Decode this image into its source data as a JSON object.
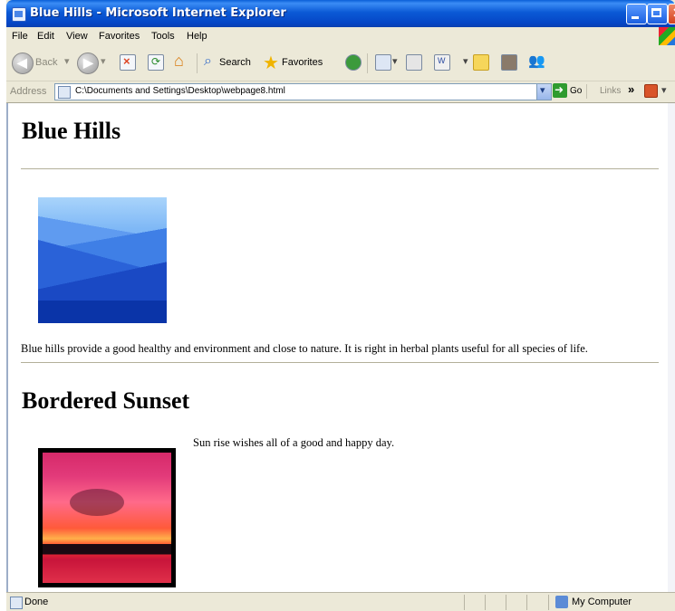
{
  "window": {
    "title": "Blue Hills - Microsoft Internet Explorer"
  },
  "menubar": {
    "items": [
      "File",
      "Edit",
      "View",
      "Favorites",
      "Tools",
      "Help"
    ]
  },
  "toolbar": {
    "back_label": "Back",
    "search_label": "Search",
    "favorites_label": "Favorites"
  },
  "addressbar": {
    "label": "Address",
    "url": "C:\\Documents and Settings\\Desktop\\webpage8.html",
    "go_label": "Go",
    "links_label": "Links",
    "chevron": "»"
  },
  "page": {
    "heading1": "Blue Hills",
    "paragraph1": "Blue hills provide a good healthy and environment and close to nature. It is right in herbal plants useful for all species of life.",
    "heading2": "Bordered Sunset",
    "paragraph2": "Sun rise wishes all of a good and happy day."
  },
  "statusbar": {
    "status": "Done",
    "zone": "My Computer"
  },
  "icons": {
    "back": "back-arrow-icon",
    "forward": "forward-arrow-icon",
    "stop": "stop-icon",
    "refresh": "refresh-icon",
    "home": "home-icon",
    "search": "search-icon",
    "favorites": "favorites-star-icon",
    "history": "history-icon",
    "mail": "mail-icon",
    "print": "print-icon",
    "edit": "edit-icon",
    "discuss": "discuss-icon",
    "research": "research-icon",
    "messenger": "messenger-icon"
  },
  "colors": {
    "titlebar": "#0a5ed8",
    "content_bg": "#ffffff",
    "chrome_bg": "#ece9d8"
  }
}
